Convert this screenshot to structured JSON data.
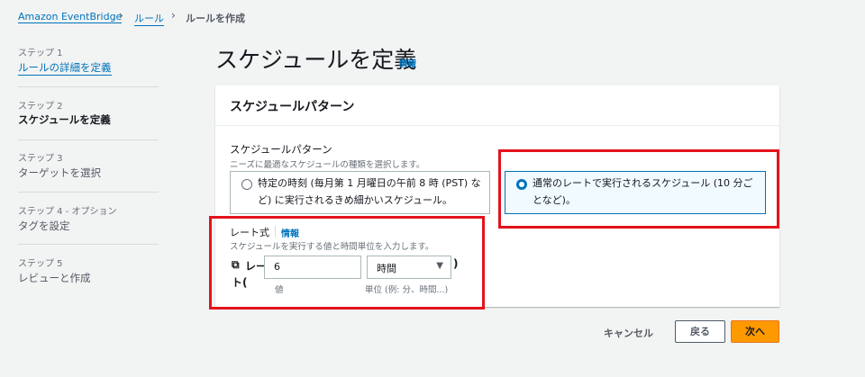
{
  "breadcrumb": {
    "items": [
      "Amazon EventBridge",
      "ルール"
    ],
    "current": "ルールを作成"
  },
  "sidebar": {
    "steps": [
      {
        "label": "ステップ 1",
        "title": "ルールの詳細を定義"
      },
      {
        "label": "ステップ 2",
        "title": "スケジュールを定義"
      },
      {
        "label": "ステップ 3",
        "title": "ターゲットを選択"
      },
      {
        "label": "ステップ 4 - オプション",
        "title": "タグを設定"
      },
      {
        "label": "ステップ 5",
        "title": "レビューと作成"
      }
    ]
  },
  "page": {
    "title": "スケジュールを定義",
    "info": "情報"
  },
  "card": {
    "title": "スケジュールパターン",
    "pattern": {
      "label": "スケジュールパターン",
      "description": "ニーズに最適なスケジュールの種類を選択します。",
      "options": [
        {
          "label": "特定の時刻 (毎月第 1 月曜日の午前 8 時 (PST) など) に実行されるきめ細かいスケジュール。",
          "selected": false
        },
        {
          "label": "通常のレートで実行されるスケジュール (10 分ごとなど)。",
          "selected": true
        }
      ]
    },
    "rate": {
      "label": "レート式",
      "info": "情報",
      "description": "スケジュールを実行する値と時間単位を入力します。",
      "prefix_line1": "レー",
      "prefix_line2": "ト(",
      "suffix": ")",
      "value": "6",
      "value_hint": "値",
      "unit": "時間",
      "unit_hint": "単位 (例: 分、時間...)"
    }
  },
  "actions": {
    "cancel": "キャンセル",
    "back": "戻る",
    "next": "次へ"
  },
  "colors": {
    "accent": "#0073bb",
    "primary_button": "#ff9900",
    "highlight": "#e4121b"
  }
}
